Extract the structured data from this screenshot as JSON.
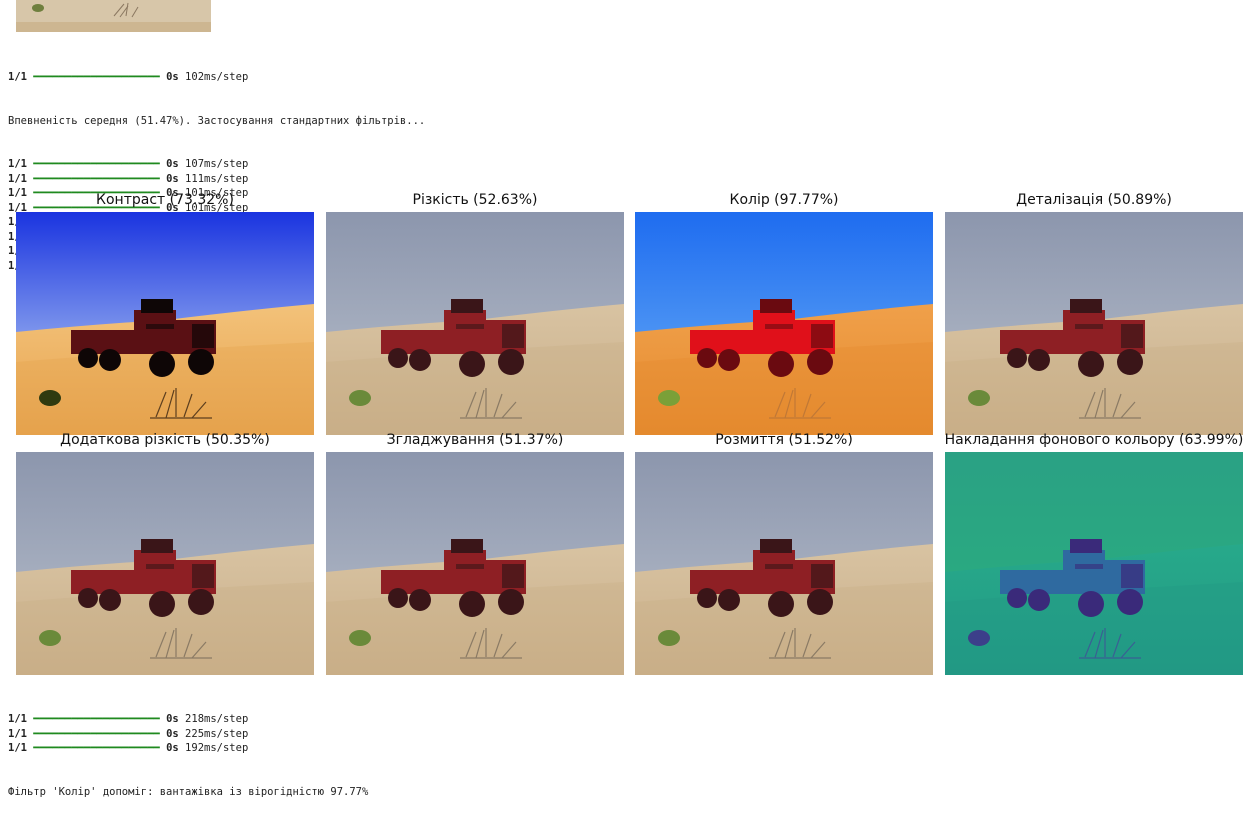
{
  "log_top": {
    "first_step": {
      "count": "1/1",
      "bar": "━━━━━━━━━━━━━━━━━━━━",
      "time": "0s",
      "rate": "102ms/step"
    },
    "message": "Впевненість середня (51.47%). Застосування стандартних фільтрів...",
    "steps": [
      {
        "count": "1/1",
        "bar": "━━━━━━━━━━━━━━━━━━━━",
        "time": "0s",
        "rate": "107ms/step"
      },
      {
        "count": "1/1",
        "bar": "━━━━━━━━━━━━━━━━━━━━",
        "time": "0s",
        "rate": "111ms/step"
      },
      {
        "count": "1/1",
        "bar": "━━━━━━━━━━━━━━━━━━━━",
        "time": "0s",
        "rate": "101ms/step"
      },
      {
        "count": "1/1",
        "bar": "━━━━━━━━━━━━━━━━━━━━",
        "time": "0s",
        "rate": "101ms/step"
      },
      {
        "count": "1/1",
        "bar": "━━━━━━━━━━━━━━━━━━━━",
        "time": "0s",
        "rate": "110ms/step"
      },
      {
        "count": "1/1",
        "bar": "━━━━━━━━━━━━━━━━━━━━",
        "time": "0s",
        "rate": "102ms/step"
      },
      {
        "count": "1/1",
        "bar": "━━━━━━━━━━━━━━━━━━━━",
        "time": "0s",
        "rate": "123ms/step"
      },
      {
        "count": "1/1",
        "bar": "━━━━━━━━━━━━━━━━━━━━",
        "time": "0s",
        "rate": "104ms/step"
      }
    ]
  },
  "grid": {
    "tiles": [
      {
        "title": "Контраст (73.32%)",
        "palette": "contrast"
      },
      {
        "title": "Різкість (52.63%)",
        "palette": "normal"
      },
      {
        "title": "Колір (97.77%)",
        "palette": "color"
      },
      {
        "title": "Деталізація (50.89%)",
        "palette": "normal"
      },
      {
        "title": "Додаткова різкість (50.35%)",
        "palette": "normal"
      },
      {
        "title": "Згладжування (51.37%)",
        "palette": "normal"
      },
      {
        "title": "Розмиття (51.52%)",
        "palette": "normal"
      },
      {
        "title": "Накладання фонового кольору (63.99%)",
        "palette": "overlay"
      }
    ]
  },
  "log_bottom": {
    "steps": [
      {
        "count": "1/1",
        "bar": "━━━━━━━━━━━━━━━━━━━━",
        "time": "0s",
        "rate": "218ms/step"
      },
      {
        "count": "1/1",
        "bar": "━━━━━━━━━━━━━━━━━━━━",
        "time": "0s",
        "rate": "225ms/step"
      },
      {
        "count": "1/1",
        "bar": "━━━━━━━━━━━━━━━━━━━━",
        "time": "0s",
        "rate": "192ms/step"
      }
    ],
    "result": "Фільтр 'Колір' допоміг: вантажівка із вірогідністю 97.77%"
  },
  "palettes": {
    "normal": {
      "sky_top": "#8c96ad",
      "sky_bottom": "#b9c0cc",
      "sand_top": "#d8c3a2",
      "sand_bottom": "#c9ae88",
      "truck": "#8e1f24",
      "truck_dark": "#3a1518",
      "shrub": "#6a8a3a",
      "brush": "#8a7a64"
    },
    "contrast": {
      "sky_top": "#1a34e0",
      "sky_bottom": "#cfe6f6",
      "sand_top": "#f3c27a",
      "sand_bottom": "#e6a24c",
      "truck": "#5a1014",
      "truck_dark": "#0e0606",
      "shrub": "#2f3a10",
      "brush": "#5c3e1e"
    },
    "color": {
      "sky_top": "#1e6cf0",
      "sky_bottom": "#6fb2f6",
      "sand_top": "#f0a04a",
      "sand_bottom": "#e48a2e",
      "truck": "#e0101a",
      "truck_dark": "#6a0a10",
      "shrub": "#7aa038",
      "brush": "#c07836"
    },
    "overlay": {
      "sky_top": "#2aa184",
      "sky_bottom": "#2ab07e",
      "sand_top": "#27a98a",
      "sand_bottom": "#229985",
      "truck": "#2f6aa0",
      "truck_dark": "#3a2a7a",
      "shrub": "#3c3f8a",
      "brush": "#3a5f94"
    }
  }
}
